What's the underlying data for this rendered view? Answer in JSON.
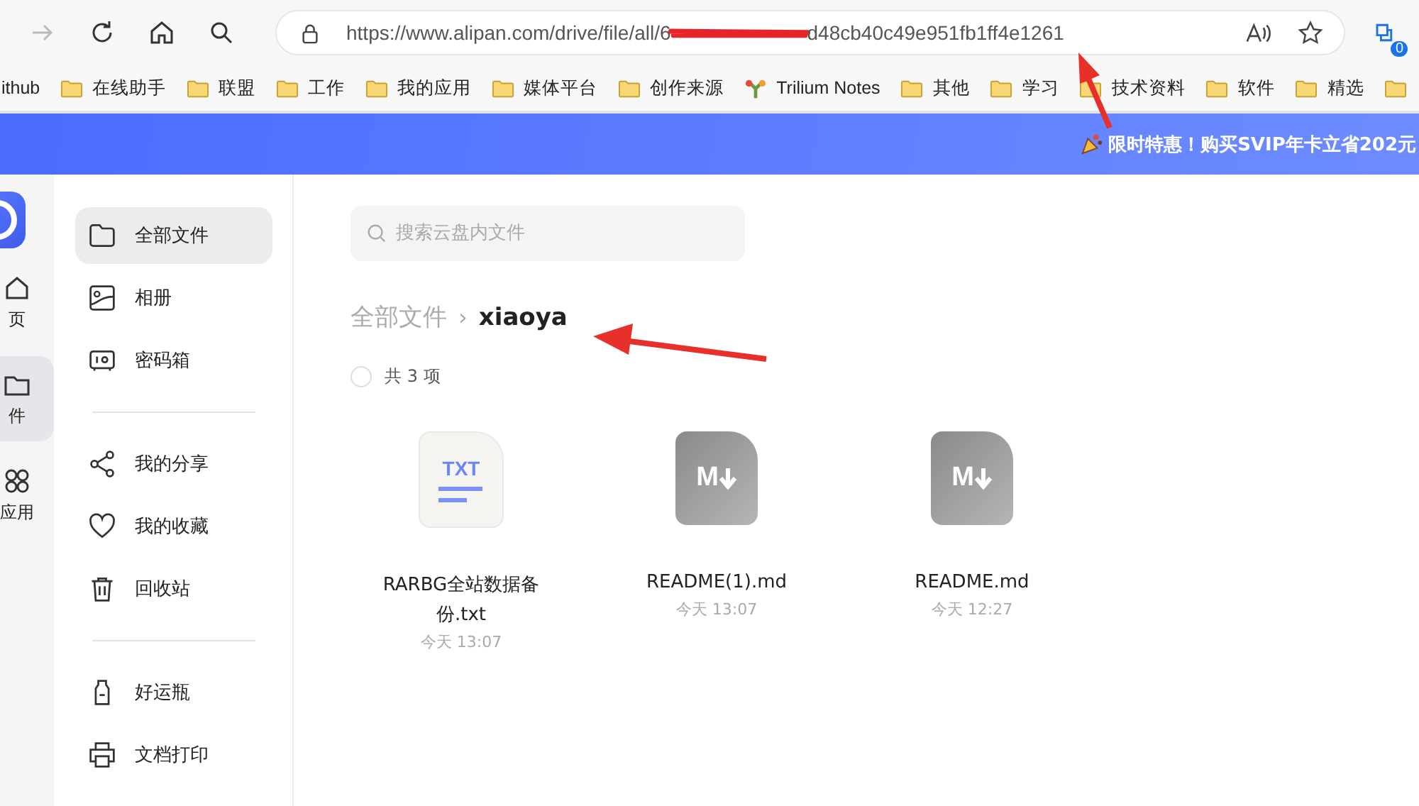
{
  "toolbar": {
    "url_start": "https://www.alipan.com/drive/file/all/6",
    "url_end": "d48cb40c49e951fb1ff4e1261",
    "extension_badge": "0"
  },
  "bookmarks": [
    {
      "kind": "plain",
      "label": "ithub"
    },
    {
      "kind": "folder",
      "label": "在线助手"
    },
    {
      "kind": "folder",
      "label": "联盟"
    },
    {
      "kind": "folder",
      "label": "工作"
    },
    {
      "kind": "folder",
      "label": "我的应用"
    },
    {
      "kind": "folder",
      "label": "媒体平台"
    },
    {
      "kind": "folder",
      "label": "创作来源"
    },
    {
      "kind": "app",
      "label": "Trilium Notes"
    },
    {
      "kind": "folder",
      "label": "其他"
    },
    {
      "kind": "folder",
      "label": "学习"
    },
    {
      "kind": "folder",
      "label": "技术资料"
    },
    {
      "kind": "folder",
      "label": "软件"
    },
    {
      "kind": "folder",
      "label": "精选"
    },
    {
      "kind": "folder"
    }
  ],
  "banner": {
    "text": "限时特惠！购买SVIP年卡立省202元"
  },
  "rail": [
    {
      "kind": "home",
      "label": "页",
      "selected": false
    },
    {
      "kind": "files",
      "label": "件",
      "selected": true
    },
    {
      "kind": "apps",
      "label": "应用",
      "selected": false
    }
  ],
  "sidebar": {
    "groups": [
      [
        {
          "kind": "folder",
          "label": "全部文件",
          "selected": true
        },
        {
          "kind": "album",
          "label": "相册",
          "selected": false
        },
        {
          "kind": "safe",
          "label": "密码箱",
          "selected": false
        }
      ],
      [
        {
          "kind": "share",
          "label": "我的分享",
          "selected": false
        },
        {
          "kind": "heart",
          "label": "我的收藏",
          "selected": false
        },
        {
          "kind": "trash",
          "label": "回收站",
          "selected": false
        }
      ],
      [
        {
          "kind": "bottle",
          "label": "好运瓶",
          "selected": false
        },
        {
          "kind": "printer",
          "label": "文档打印",
          "selected": false
        }
      ]
    ]
  },
  "search": {
    "placeholder": "搜索云盘内文件"
  },
  "breadcrumb_separator": "›",
  "breadcrumb": [
    {
      "label": "全部文件",
      "current": false
    },
    {
      "label": "xiaoya",
      "current": true
    }
  ],
  "select_all": {
    "checked": false,
    "count": "共 3 项"
  },
  "files": [
    {
      "kind": "txt",
      "icon_text": "TXT",
      "name": "RARBG全站数据备份.txt",
      "time": "今天 13:07"
    },
    {
      "kind": "md",
      "icon_text": "M",
      "name": "README(1).md",
      "time": "今天 13:07"
    },
    {
      "kind": "md",
      "icon_text": "M",
      "name": "README.md",
      "time": "今天 12:27"
    }
  ]
}
